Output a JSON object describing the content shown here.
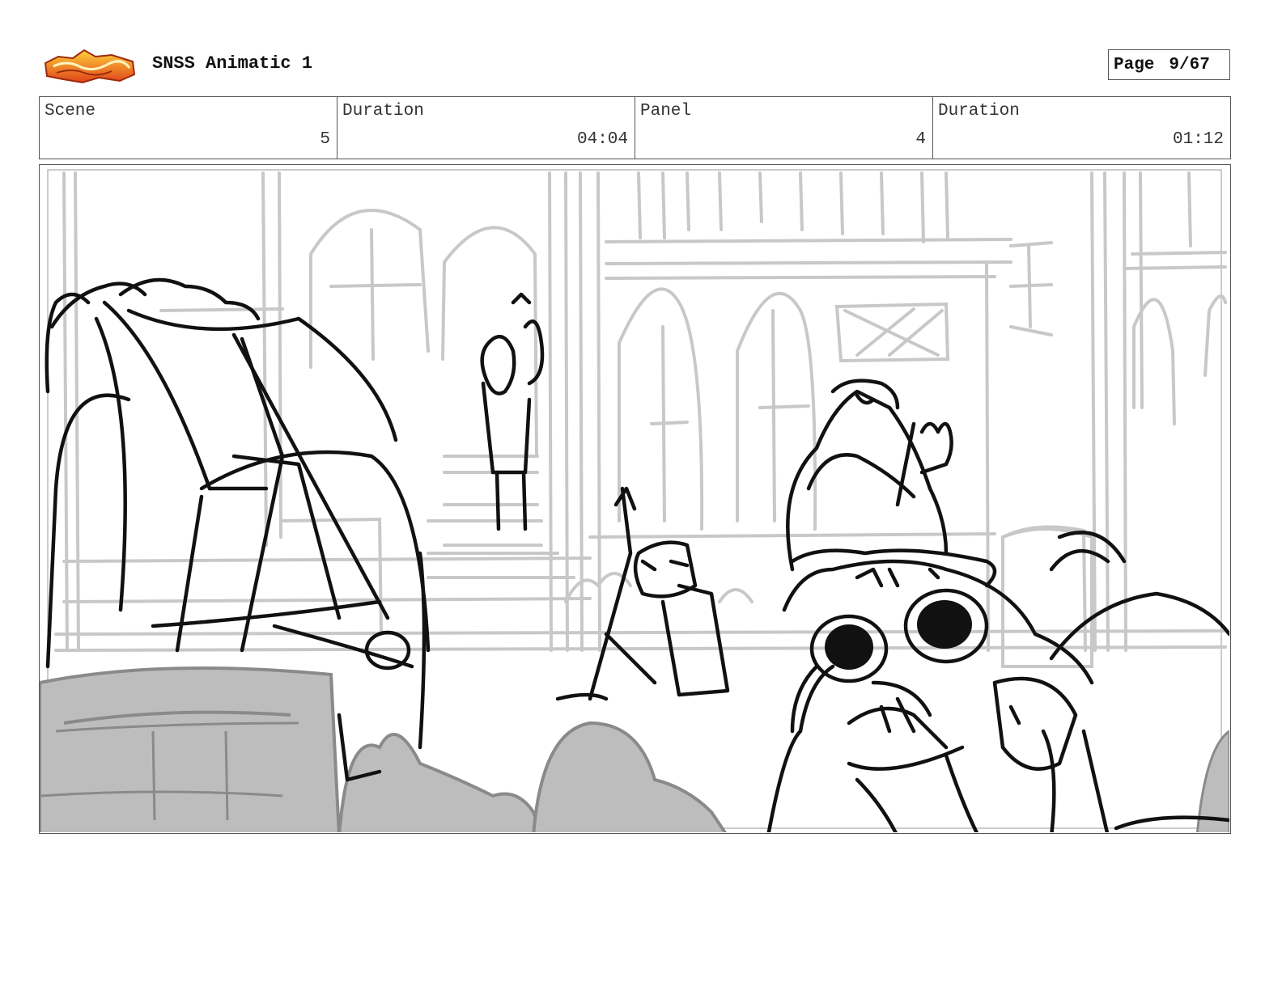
{
  "header": {
    "logo_icon": "sir-fuce-so-stoe-logo-icon",
    "title": "SNSS Animatic 1",
    "page_label": "Page",
    "page_value": "9/67"
  },
  "info": {
    "scene_label": "Scene",
    "scene_value": "5",
    "scene_duration_label": "Duration",
    "scene_duration_value": "04:04",
    "panel_label": "Panel",
    "panel_value": "4",
    "panel_duration_label": "Duration",
    "panel_duration_value": "01:12"
  },
  "panel": {
    "image_icon": "storyboard-sketch-image",
    "colors": {
      "ink": "#111111",
      "background_sketch": "#c8c8c8",
      "fill_gray": "#bdbdbd"
    }
  }
}
